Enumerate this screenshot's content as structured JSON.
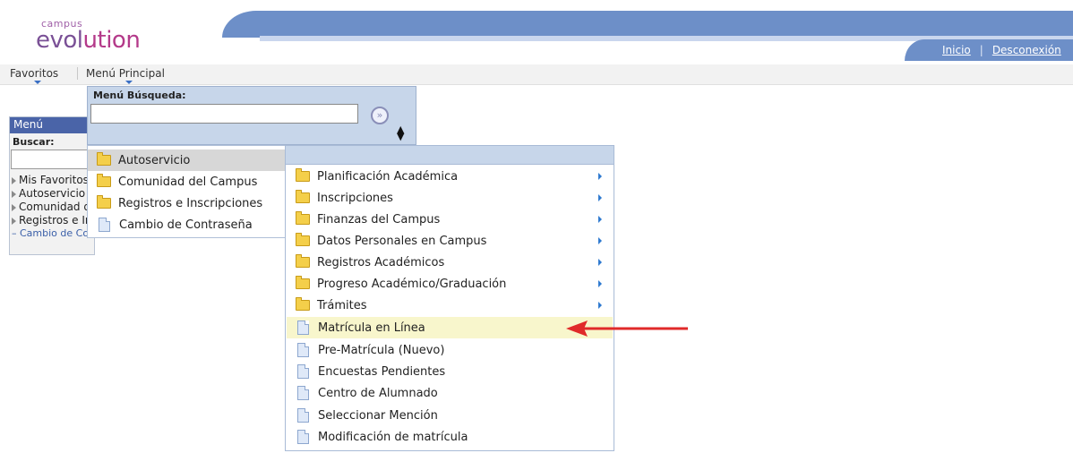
{
  "logo": {
    "small": "campus",
    "main_a": "evol",
    "main_b": "ution"
  },
  "header_nav": {
    "home": "Inicio",
    "separator": "|",
    "logout": "Desconexión"
  },
  "menubar": {
    "favorites": "Favoritos",
    "main_menu": "Menú Principal"
  },
  "left_panel": {
    "title": "Menú",
    "search_label": "Buscar:",
    "items": [
      "Mis Favoritos",
      "Autoservicio",
      "Comunidad del Campus",
      "Registros e Inscripciones"
    ],
    "last_item": "– Cambio de Contraseña"
  },
  "search_panel": {
    "label": "Menú Búsqueda:",
    "go_symbol": "»",
    "sort_symbol": "▲▼",
    "input_value": ""
  },
  "menu_level1": [
    {
      "label": "Autoservicio",
      "icon": "folder-icon"
    },
    {
      "label": "Comunidad del Campus",
      "icon": "folder-icon"
    },
    {
      "label": "Registros e Inscripciones",
      "icon": "folder-icon"
    },
    {
      "label": "Cambio de Contraseña",
      "icon": "document-icon"
    }
  ],
  "menu_level2": [
    {
      "label": "Planificación Académica",
      "icon": "folder-icon"
    },
    {
      "label": "Inscripciones",
      "icon": "folder-icon"
    },
    {
      "label": "Finanzas del Campus",
      "icon": "folder-icon"
    },
    {
      "label": "Datos Personales en Campus",
      "icon": "folder-icon"
    },
    {
      "label": "Registros Académicos",
      "icon": "folder-icon"
    },
    {
      "label": "Progreso Académico/Graduación",
      "icon": "folder-icon"
    },
    {
      "label": "Trámites",
      "icon": "folder-icon"
    },
    {
      "label": "Matrícula en Línea",
      "icon": "document-icon"
    },
    {
      "label": "Pre-Matrícula (Nuevo)",
      "icon": "document-icon"
    },
    {
      "label": "Encuestas Pendientes",
      "icon": "document-icon"
    },
    {
      "label": "Centro de Alumnado",
      "icon": "document-icon"
    },
    {
      "label": "Seleccionar Mención",
      "icon": "document-icon"
    },
    {
      "label": "Modificación de matrícula",
      "icon": "document-icon"
    }
  ],
  "colors": {
    "header_blue": "#6d8fc8",
    "menu_panel_blue": "#c7d6ea",
    "highlight_yellow": "#f8f6cc",
    "arrow_red": "#e02a2a",
    "logo_purple": "#7a5096",
    "logo_magenta": "#b43a8a"
  }
}
